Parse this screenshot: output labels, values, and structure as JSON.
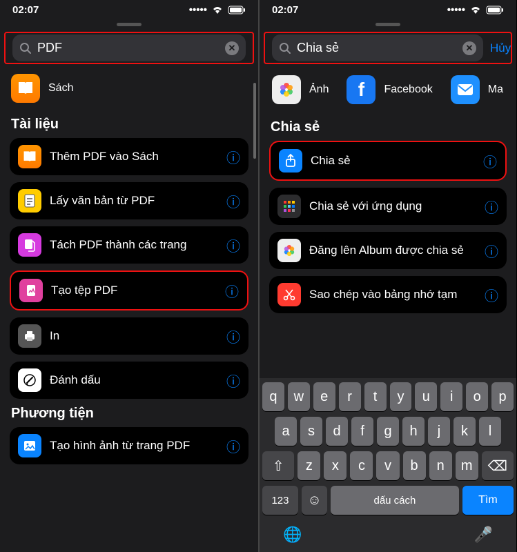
{
  "left": {
    "status": {
      "time": "02:07"
    },
    "search": {
      "value": "PDF"
    },
    "suggestion": {
      "label": "Sách",
      "icon": "book-icon"
    },
    "sections": [
      {
        "title": "Tài liệu",
        "items": [
          {
            "label": "Thêm PDF vào Sách",
            "icon": "book-icon",
            "bg": "bg-orange",
            "highlighted": false
          },
          {
            "label": "Lấy văn bản từ PDF",
            "icon": "doc-text-icon",
            "bg": "bg-yellow",
            "highlighted": false
          },
          {
            "label": "Tách PDF thành các trang",
            "icon": "doc-split-icon",
            "bg": "bg-magenta",
            "highlighted": false
          },
          {
            "label": "Tạo tệp PDF",
            "icon": "doc-make-icon",
            "bg": "bg-pink",
            "highlighted": true
          },
          {
            "label": "In",
            "icon": "printer-icon",
            "bg": "bg-gray",
            "highlighted": false
          },
          {
            "label": "Đánh dấu",
            "icon": "markup-icon",
            "bg": "bg-white",
            "highlighted": false
          }
        ]
      },
      {
        "title": "Phương tiện",
        "items": [
          {
            "label": "Tạo hình ảnh từ trang PDF",
            "icon": "image-icon",
            "bg": "bg-blue",
            "highlighted": false
          }
        ]
      }
    ]
  },
  "right": {
    "status": {
      "time": "02:07"
    },
    "search": {
      "value": "Chia sẻ",
      "cancel": "Hủy"
    },
    "suggestions": [
      {
        "label": "Ảnh",
        "icon": "photos-icon",
        "bg": "bg-photos"
      },
      {
        "label": "Facebook",
        "icon": "facebook-icon",
        "bg": "bg-fb"
      },
      {
        "label": "Ma",
        "icon": "mail-icon",
        "bg": "bg-mail"
      }
    ],
    "sections": [
      {
        "title": "Chia sẻ",
        "items": [
          {
            "label": "Chia sẻ",
            "icon": "share-icon",
            "bg": "bg-blue",
            "highlighted": true
          },
          {
            "label": "Chia sẻ với ứng dụng",
            "icon": "grid-icon",
            "bg": "bg-grid",
            "highlighted": false
          },
          {
            "label": "Đăng lên Album được chia sẻ",
            "icon": "photos-icon",
            "bg": "bg-photos",
            "highlighted": false
          },
          {
            "label": "Sao chép vào bảng nhớ tạm",
            "icon": "scissors-icon",
            "bg": "bg-red",
            "highlighted": false
          }
        ]
      }
    ],
    "keyboard": {
      "rows": [
        [
          "q",
          "w",
          "e",
          "r",
          "t",
          "y",
          "u",
          "i",
          "o",
          "p"
        ],
        [
          "a",
          "s",
          "d",
          "f",
          "g",
          "h",
          "j",
          "k",
          "l"
        ],
        [
          "⇧",
          "z",
          "x",
          "c",
          "v",
          "b",
          "n",
          "m",
          "⌫"
        ]
      ],
      "num": "123",
      "space": "dấu cách",
      "return": "Tìm"
    }
  }
}
